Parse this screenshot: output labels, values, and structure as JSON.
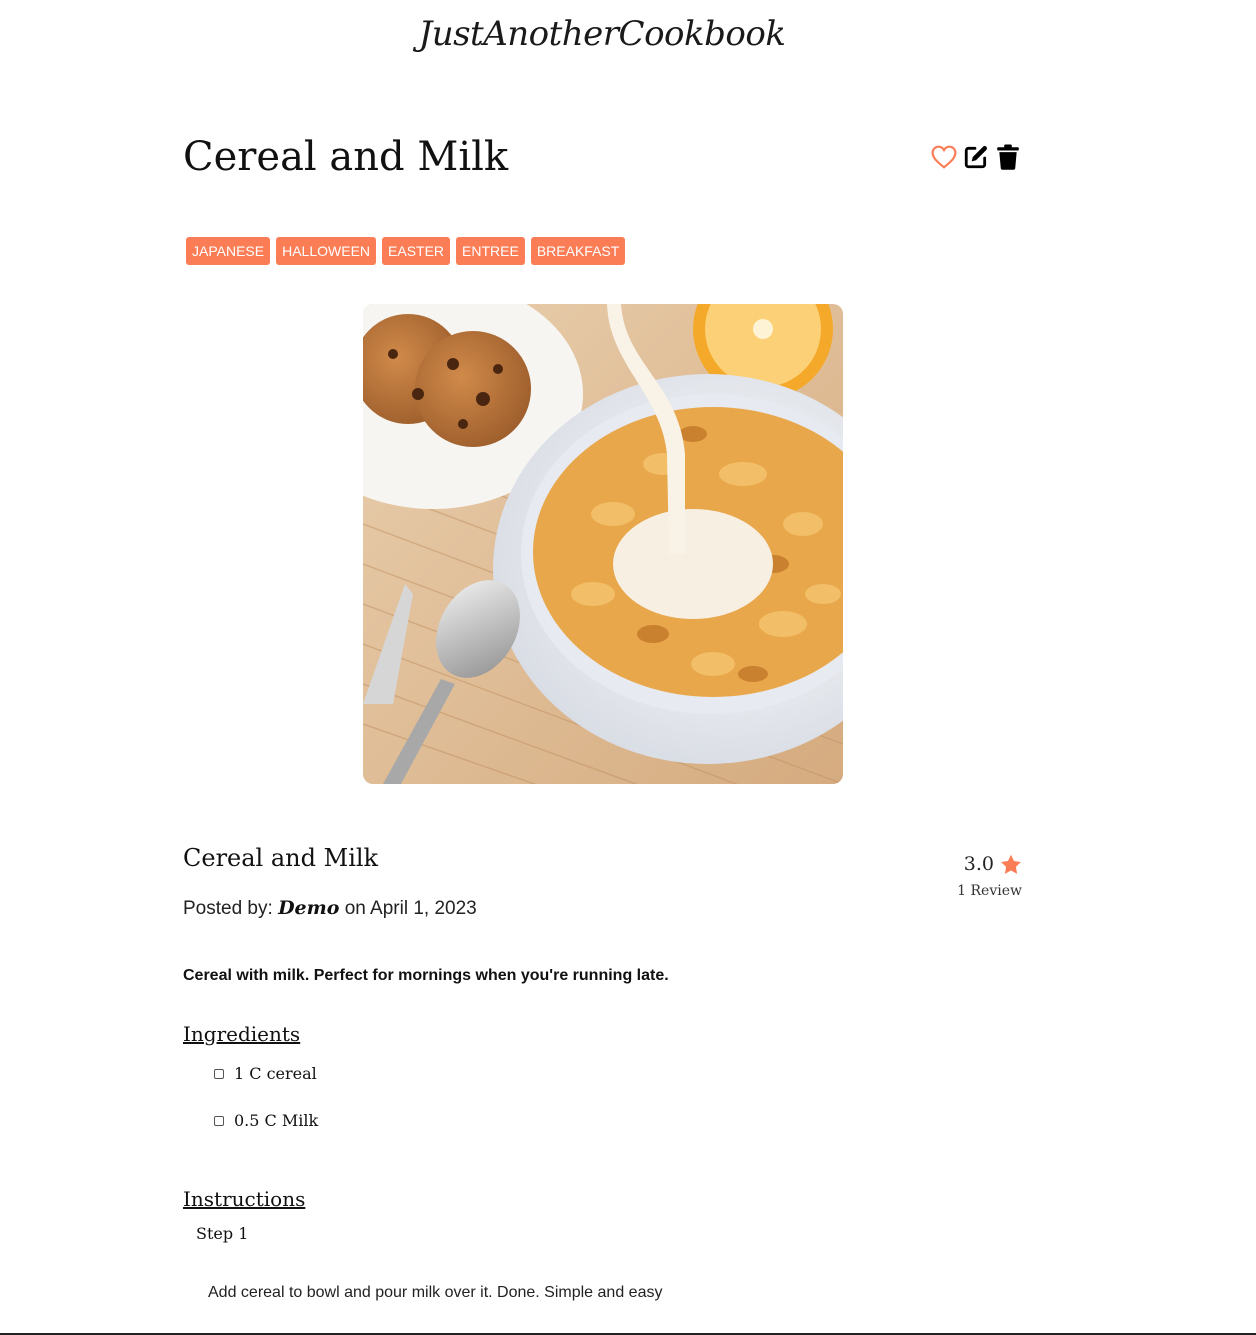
{
  "brand": "JustAnotherCookbook",
  "recipe": {
    "title": "Cereal and Milk",
    "subtitle": "Cereal and Milk",
    "posted_prefix": "Posted by:",
    "author": "Demo",
    "posted_on": "on April 1, 2023",
    "rating": "3.0",
    "reviews": "1 Review",
    "description": "Cereal with milk. Perfect for mornings when you're running late."
  },
  "tags": [
    "JAPANESE",
    "HALLOWEEN",
    "EASTER",
    "ENTREE",
    "BREAKFAST"
  ],
  "actions": {
    "favorite_icon": "heart-icon",
    "edit_icon": "edit-icon",
    "delete_icon": "trash-icon"
  },
  "ingredients": {
    "heading": "Ingredients",
    "items": [
      "1 C cereal",
      "0.5 C Milk"
    ]
  },
  "instructions": {
    "heading": "Instructions",
    "steps": [
      {
        "label": "Step 1",
        "text": "Add cereal to bowl and pour milk over it. Done. Simple and easy"
      }
    ]
  },
  "colors": {
    "accent": "#fb7d56",
    "text": "#111111",
    "background": "#ffffff"
  }
}
